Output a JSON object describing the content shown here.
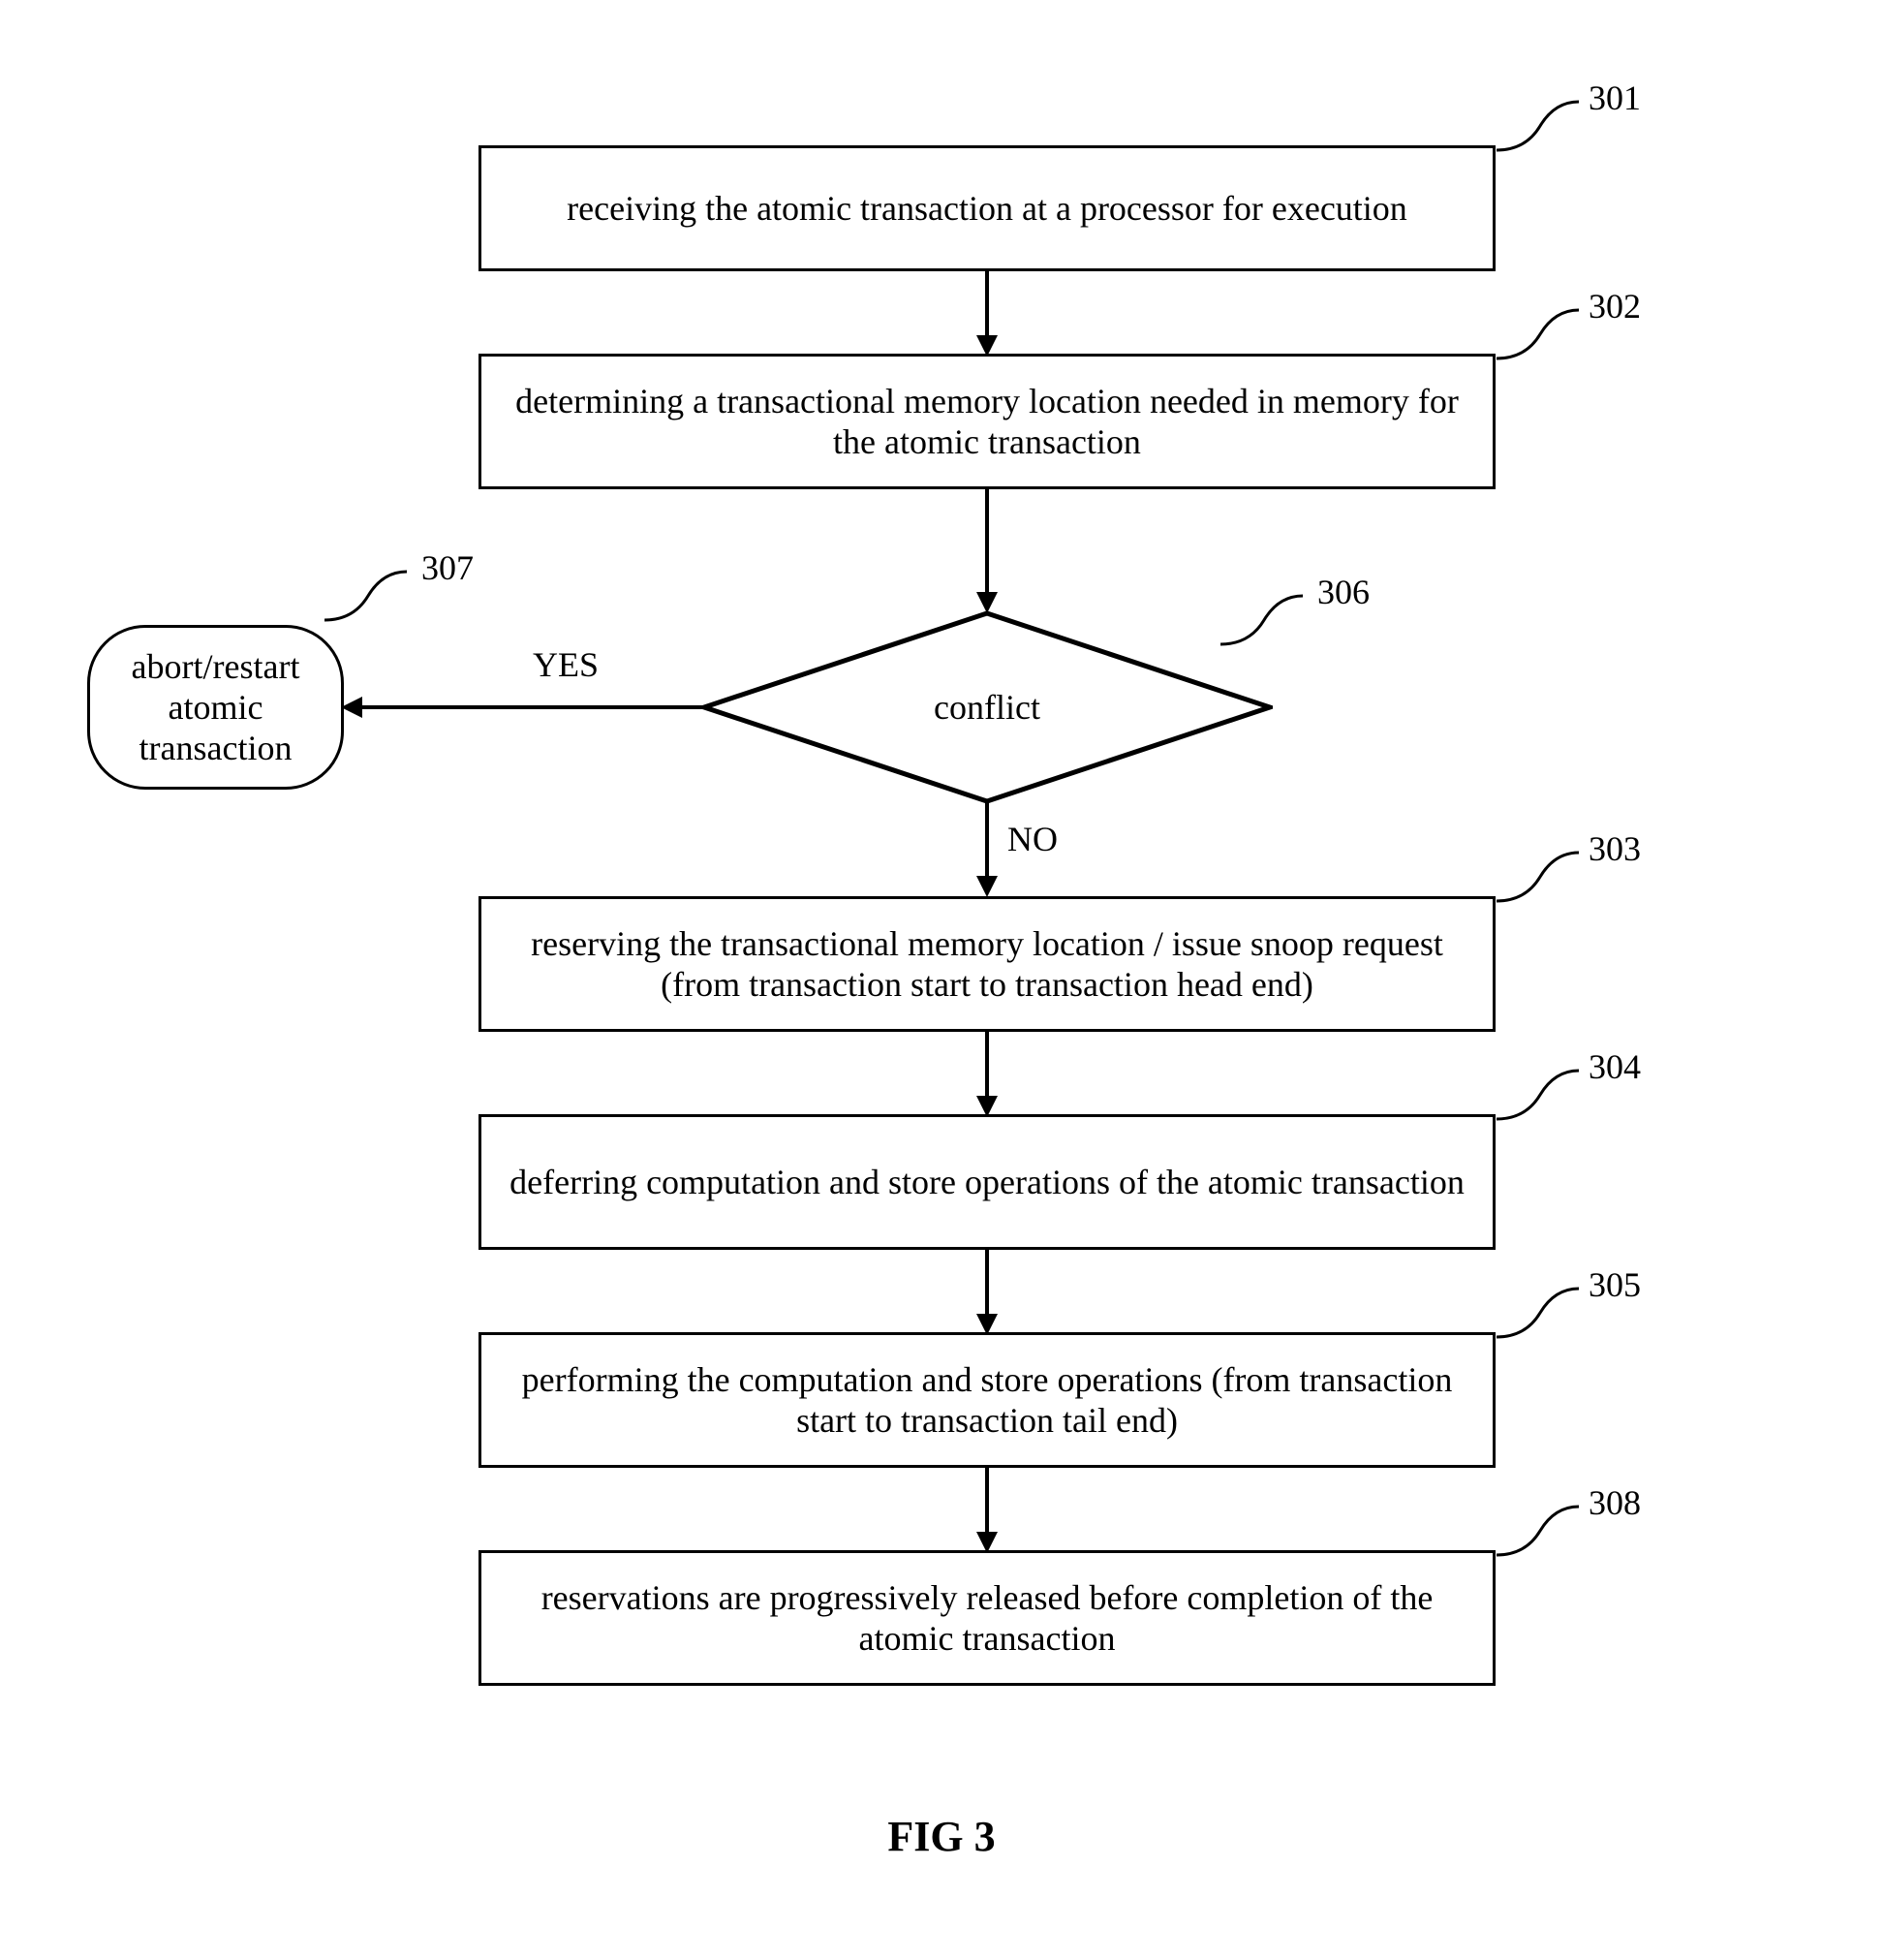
{
  "boxes": {
    "b301": "receiving the atomic transaction at a processor for execution",
    "b302": "determining a transactional memory location needed in memory for the atomic transaction",
    "b303": "reserving the transactional memory location / issue snoop request (from transaction start to transaction head end)",
    "b304": "deferring computation and store operations of the atomic transaction",
    "b305": "performing the computation and store operations (from transaction start to transaction tail end)",
    "b308": "reservations are progressively released before completion of the atomic transaction"
  },
  "terminal": {
    "b307": "abort/restart atomic transaction"
  },
  "decision": {
    "b306": "conflict"
  },
  "labels": {
    "yes": "YES",
    "no": "NO"
  },
  "refs": {
    "r301": "301",
    "r302": "302",
    "r303": "303",
    "r304": "304",
    "r305": "305",
    "r306": "306",
    "r307": "307",
    "r308": "308"
  },
  "figure": "FIG 3"
}
